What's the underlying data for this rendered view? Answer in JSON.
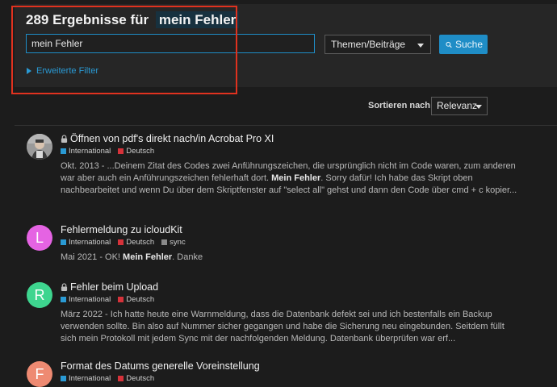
{
  "header": {
    "result_prefix": "289 Ergebnisse für",
    "search_term": "mein Fehler"
  },
  "search": {
    "value": "mein Fehler",
    "type_select": "Themen/Beiträge",
    "button_label": "Suche",
    "advanced_filter": "Erweiterte Filter"
  },
  "sort": {
    "label": "Sortieren nach",
    "value": "Relevanz"
  },
  "colors": {
    "accent": "#1f8dc6",
    "highlight_box": "#e0321f",
    "tag_international": "#2a9ad4",
    "tag_deutsch": "#d6323a",
    "tag_sync": "#8a8a8a"
  },
  "results": [
    {
      "title": "Öffnen von pdf's direkt nach/in Acrobat Pro XI",
      "locked": true,
      "avatar": "photo",
      "tags": [
        "International",
        "Deutsch"
      ],
      "date": "Okt. 2013",
      "excerpt_before": " - ...Deinem Zitat des Codes zwei Anführungszeichen, die ursprünglich nicht im Code waren, zum anderen war aber auch ein Anführungszeichen fehlerhaft dort. ",
      "match": "Mein Fehler",
      "excerpt_after": ". Sorry dafür! Ich habe das Skript oben nachbearbeitet und wenn Du über dem Skriptfenster auf \"select all\" gehst und dann den Code über cmd + c kopier..."
    },
    {
      "title": "Fehlermeldung zu icloudKit",
      "locked": false,
      "avatar": "L",
      "avatar_color": "#e563e3",
      "tags": [
        "International",
        "Deutsch",
        "sync"
      ],
      "date": "Mai 2021",
      "excerpt_before": " - OK! ",
      "match": "Mein Fehler",
      "excerpt_after": ". Danke"
    },
    {
      "title": "Fehler beim Upload",
      "locked": true,
      "avatar": "R",
      "avatar_color": "#3ed58f",
      "tags": [
        "International",
        "Deutsch"
      ],
      "date": "März 2022",
      "excerpt_before": " - Ich hatte heute eine Warnmeldung, dass die Datenbank defekt sei und ich bestenfalls ein Backup verwenden sollte. Bin also auf Nummer sicher gegangen und habe die Sicherung neu eingebunden. Seitdem füllt sich mein Protokoll mit jedem Sync mit der nachfolgenden Meldung. Datenbank überprüfen war erf...",
      "match": "",
      "excerpt_after": ""
    },
    {
      "title": "Format des Datums generelle Voreinstellung",
      "locked": false,
      "avatar": "F",
      "avatar_color": "#ee8a72",
      "tags": [
        "International",
        "Deutsch"
      ]
    }
  ]
}
